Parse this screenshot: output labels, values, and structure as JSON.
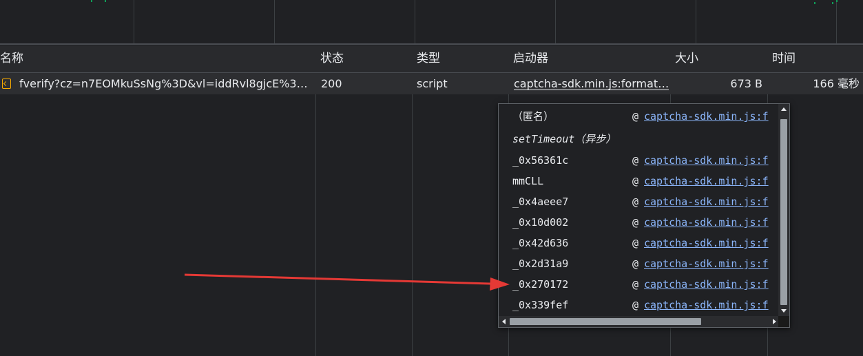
{
  "table": {
    "columns": [
      {
        "key": "name",
        "label": "名称"
      },
      {
        "key": "status",
        "label": "状态"
      },
      {
        "key": "type",
        "label": "类型"
      },
      {
        "key": "initiator",
        "label": "启动器"
      },
      {
        "key": "size",
        "label": "大小"
      },
      {
        "key": "time",
        "label": "时间"
      }
    ],
    "rows": [
      {
        "name": "fverify?cz=n7EOMkuSsNg%3D&vl=iddRvl8gjcE%3D…",
        "status": "200",
        "type": "script",
        "initiator": "captcha-sdk.min.js:format…",
        "size": "673 B",
        "time": "166 毫秒"
      }
    ]
  },
  "initiator_popup": {
    "frames": [
      {
        "fn": "（匿名）",
        "at": "@",
        "loc": "captcha-sdk.min.js:f"
      },
      {
        "fn": "setTimeout（异步）",
        "at": "",
        "loc": ""
      },
      {
        "fn": "_0x56361c",
        "at": "@",
        "loc": "captcha-sdk.min.js:f"
      },
      {
        "fn": "mmCLL",
        "at": "@",
        "loc": "captcha-sdk.min.js:f"
      },
      {
        "fn": "_0x4aeee7",
        "at": "@",
        "loc": "captcha-sdk.min.js:f"
      },
      {
        "fn": "_0x10d002",
        "at": "@",
        "loc": "captcha-sdk.min.js:f"
      },
      {
        "fn": "_0x42d636",
        "at": "@",
        "loc": "captcha-sdk.min.js:f"
      },
      {
        "fn": "_0x2d31a9",
        "at": "@",
        "loc": "captcha-sdk.min.js:f"
      },
      {
        "fn": "_0x270172",
        "at": "@",
        "loc": "captcha-sdk.min.js:f"
      },
      {
        "fn": "_0x339fef",
        "at": "@",
        "loc": "captcha-sdk.min.js:f"
      }
    ]
  },
  "colors": {
    "background": "#202124",
    "header": "#292a2d",
    "selected_row": "#2d2e31",
    "link": "#8ab4f8",
    "script_icon": "#f9ab00",
    "annotation_arrow": "#e53935"
  },
  "icons": {
    "row_type_icon": "script-file-icon",
    "annotation": "red-arrow-pointer"
  }
}
